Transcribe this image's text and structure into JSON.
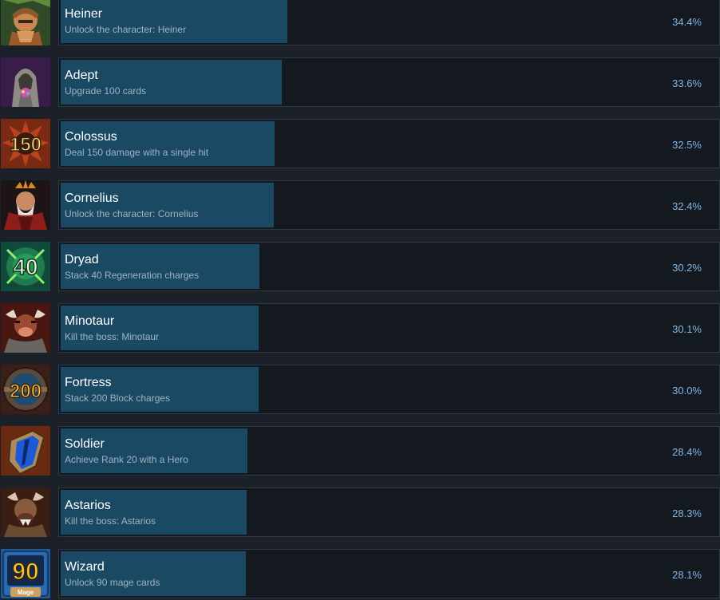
{
  "achievements": [
    {
      "name": "Heiner",
      "description": "Unlock the character: Heiner",
      "percent_label": "34.4%",
      "percent": 34.4,
      "icon": "heiner-portrait-icon",
      "icon_text": ""
    },
    {
      "name": "Adept",
      "description": "Upgrade 100 cards",
      "percent_label": "33.6%",
      "percent": 33.6,
      "icon": "adept-robed-figure-icon",
      "icon_text": ""
    },
    {
      "name": "Colossus",
      "description": "Deal 150 damage with a single hit",
      "percent_label": "32.5%",
      "percent": 32.5,
      "icon": "damage-150-icon",
      "icon_text": "150"
    },
    {
      "name": "Cornelius",
      "description": "Unlock the character: Cornelius",
      "percent_label": "32.4%",
      "percent": 32.4,
      "icon": "cornelius-portrait-icon",
      "icon_text": ""
    },
    {
      "name": "Dryad",
      "description": "Stack 40 Regeneration charges",
      "percent_label": "30.2%",
      "percent": 30.2,
      "icon": "regeneration-40-icon",
      "icon_text": "40"
    },
    {
      "name": "Minotaur",
      "description": "Kill the boss: Minotaur",
      "percent_label": "30.1%",
      "percent": 30.1,
      "icon": "minotaur-portrait-icon",
      "icon_text": ""
    },
    {
      "name": "Fortress",
      "description": "Stack 200 Block charges",
      "percent_label": "30.0%",
      "percent": 30.0,
      "icon": "block-200-shield-icon",
      "icon_text": "200"
    },
    {
      "name": "Soldier",
      "description": "Achieve Rank 20 with a Hero",
      "percent_label": "28.4%",
      "percent": 28.4,
      "icon": "rank-shield-icon",
      "icon_text": ""
    },
    {
      "name": "Astarios",
      "description": "Kill the boss: Astarios",
      "percent_label": "28.3%",
      "percent": 28.3,
      "icon": "astarios-portrait-icon",
      "icon_text": ""
    },
    {
      "name": "Wizard",
      "description": "Unlock 90 mage cards",
      "percent_label": "28.1%",
      "percent": 28.1,
      "icon": "mage-90-icon",
      "icon_text": "90",
      "icon_subtext": "Mage"
    }
  ],
  "colors": {
    "background": "#1b2029",
    "panel": "#141920",
    "bar": "#1a4963",
    "name": "#ffffff",
    "description": "#9fb3c4",
    "percent": "#7fb6e6"
  }
}
